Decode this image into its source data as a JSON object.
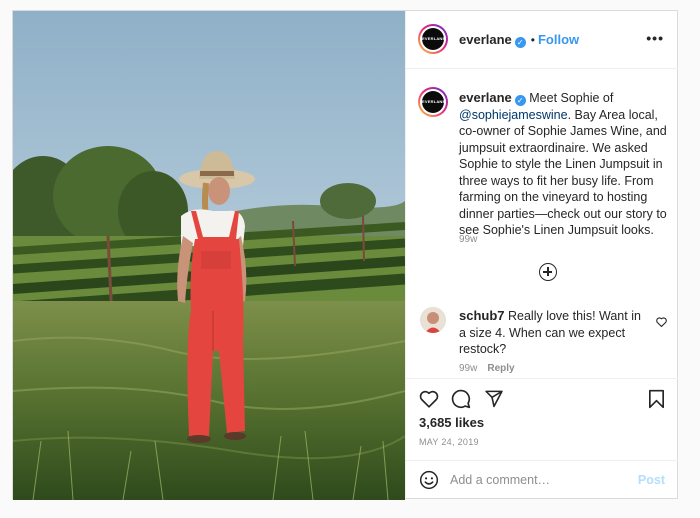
{
  "post": {
    "username": "everlane",
    "avatar_text": "EVERLANE",
    "verified_icon": "verified-badge-icon",
    "separator": "•",
    "follow_label": "Follow",
    "more_icon": "more-options-icon"
  },
  "caption": {
    "username": "everlane",
    "pre_mention": "Meet Sophie of ",
    "mention": "@sophiejameswine",
    "text": ". Bay Area local, co-owner of Sophie James Wine, and jumpsuit extraordinaire. We asked Sophie to style the Linen Jumpsuit in three ways to fit her busy life. From farming on the vineyard to hosting dinner parties—check out our story to see Sophie's Linen Jumpsuit looks.",
    "timestamp": "99w"
  },
  "load_more_icon": "plus-circle-icon",
  "comment": {
    "username": "schub7",
    "text": "Really love this! Want in a size 4. When can we expect restock?",
    "timestamp": "99w",
    "reply_label": "Reply"
  },
  "actions": {
    "icons": [
      "heart-icon",
      "comment-icon",
      "share-icon",
      "bookmark-icon"
    ],
    "likes": "3,685 likes",
    "date": "MAY 24, 2019"
  },
  "add_comment": {
    "emoji_icon": "smiley-icon",
    "placeholder": "Add a comment…",
    "post_label": "Post"
  },
  "colors": {
    "accent": "#3897f0",
    "mention": "#00376b",
    "post_disabled": "#b2dffc",
    "jumpsuit": "#e5453f"
  }
}
